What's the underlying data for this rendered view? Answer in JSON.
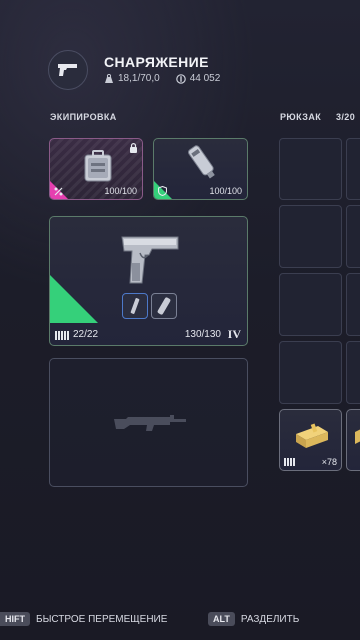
{
  "header": {
    "title": "СНАРЯЖЕНИЕ",
    "weight": "18,1/70,0",
    "money": "44 052",
    "icon": "pistol-icon"
  },
  "equipment": {
    "label": "ЭКИПИРОВКА",
    "slot_case": {
      "count": "100/100",
      "icon": "tool-case-icon",
      "badge_icon": "percent-icon",
      "lock_icon": "lock-icon"
    },
    "slot_medkit": {
      "count": "100/100",
      "icon": "sprayer-icon",
      "badge_icon": "shield-icon"
    },
    "weapon": {
      "ammo": "22/22",
      "durability": "130/130",
      "tier": "IV",
      "icon": "pistol-icon"
    },
    "secondary": {
      "icon": "rifle-silhouette-icon"
    }
  },
  "backpack": {
    "label": "РЮКЗАК",
    "capacity": "3/20",
    "ammo_item": {
      "count": "×78",
      "icon": "ammo-box-icon"
    }
  },
  "bottom": {
    "shift_key": "HIFT",
    "shift_label": "БЫСТРОЕ ПЕРЕМЕЩЕНИЕ",
    "alt_key": "ALT",
    "alt_label": "РАЗДЕЛИТЬ"
  },
  "colors": {
    "accent_green": "#35d07a",
    "accent_magenta": "#e63fb0",
    "background": "#1e1f2b"
  }
}
